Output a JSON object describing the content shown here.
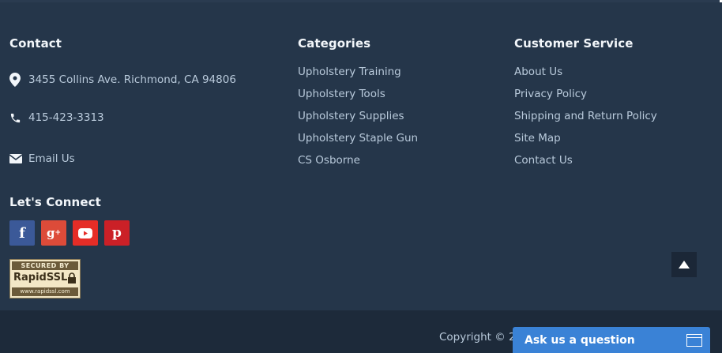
{
  "contact": {
    "title": "Contact",
    "address": "3455 Collins Ave. Richmond, CA 94806",
    "phone": "415-423-3313",
    "email": "Email Us"
  },
  "categories": {
    "title": "Categories",
    "items": [
      "Upholstery Training",
      "Upholstery Tools",
      "Upholstery Supplies",
      "Upholstery Staple Gun",
      "CS Osborne"
    ]
  },
  "customer_service": {
    "title": "Customer Service",
    "items": [
      "About Us",
      "Privacy Policy",
      "Shipping and Return Policy",
      "Site Map",
      "Contact Us"
    ]
  },
  "connect": {
    "title": "Let's Connect",
    "icons": [
      "facebook-icon",
      "google-plus-icon",
      "youtube-icon",
      "pinterest-icon"
    ],
    "colors": {
      "facebook": "#3b5998",
      "google_plus": "#dd4b39",
      "youtube": "#e52d27",
      "pinterest": "#cb2027"
    }
  },
  "ssl_badge": {
    "line1": "SECURED BY",
    "brand": "RapidSSL.",
    "url": "www.rapidssl.com"
  },
  "footer": {
    "copyright": "Copyright © 2"
  },
  "chat": {
    "label": "Ask us a question",
    "accent": "#3a82d6"
  }
}
